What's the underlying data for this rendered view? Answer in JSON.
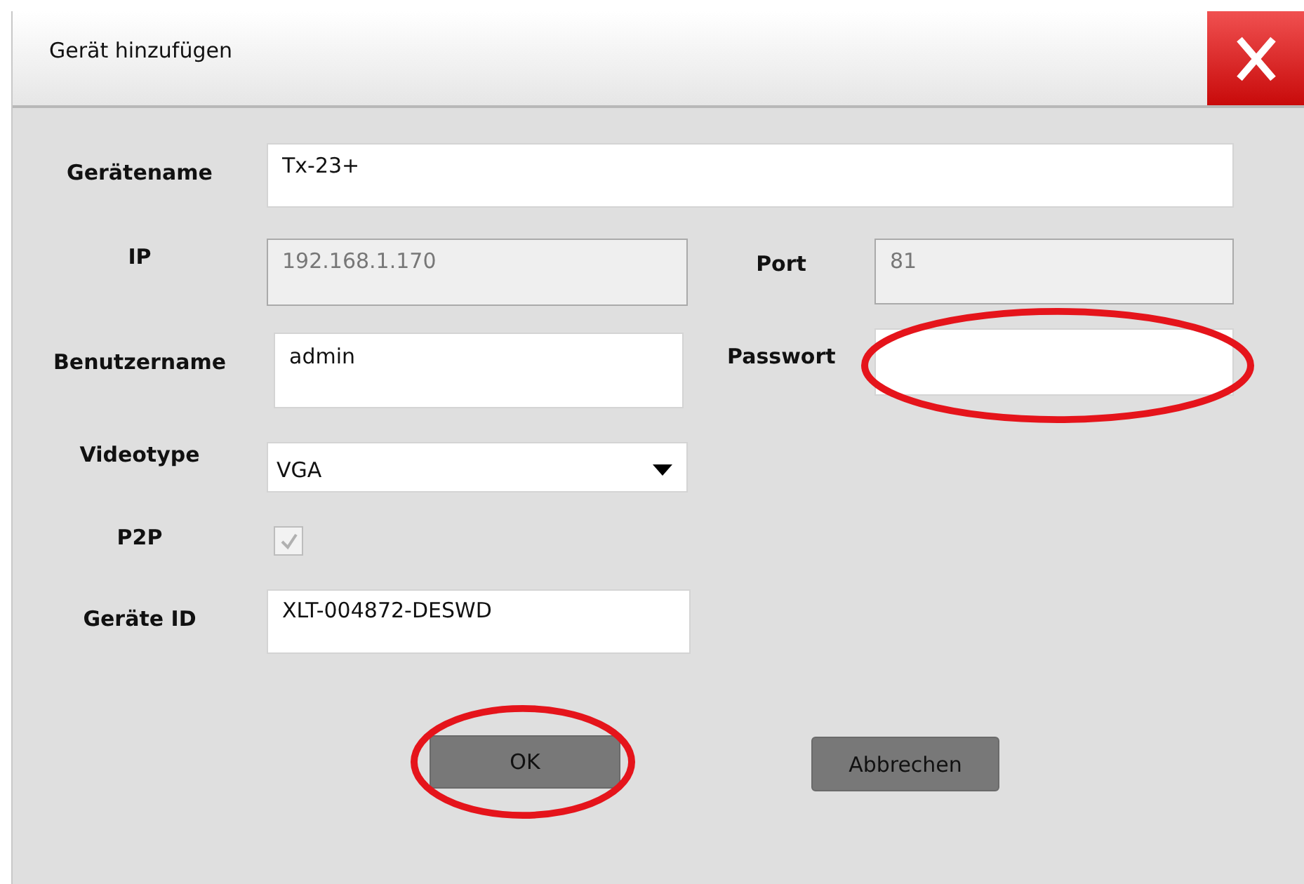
{
  "window": {
    "title": "Gerät hinzufügen"
  },
  "rows": [
    {
      "fields": [
        {
          "label": "Gerätename",
          "kind": "text",
          "value": "Tx-23+",
          "disabled": false,
          "circled": false
        }
      ]
    },
    {
      "fields": [
        {
          "label": "IP",
          "kind": "text",
          "value": "192.168.1.170",
          "disabled": true,
          "circled": false
        },
        {
          "label": "Port",
          "kind": "text",
          "value": "81",
          "disabled": true,
          "circled": false
        }
      ]
    },
    {
      "fields": [
        {
          "label": "Benutzername",
          "kind": "text",
          "value": "admin",
          "disabled": false,
          "circled": false
        },
        {
          "label": "Passwort",
          "kind": "password",
          "disabled": false,
          "circled": true
        }
      ]
    },
    {
      "fields": [
        {
          "label": "Videotype",
          "kind": "select",
          "value": "VGA",
          "disabled": false,
          "circled": false
        }
      ]
    },
    {
      "fields": [
        {
          "label": "P2P",
          "kind": "checkbox",
          "checked": true,
          "disabled": true,
          "circled": false
        }
      ]
    },
    {
      "fields": [
        {
          "label": "Geräte ID",
          "kind": "text",
          "value": "XLT-004872-DESWD",
          "disabled": false,
          "circled": false
        }
      ]
    }
  ],
  "buttons": [
    {
      "label": "OK",
      "circled": true
    },
    {
      "label": "Abbrechen",
      "circled": false
    }
  ]
}
